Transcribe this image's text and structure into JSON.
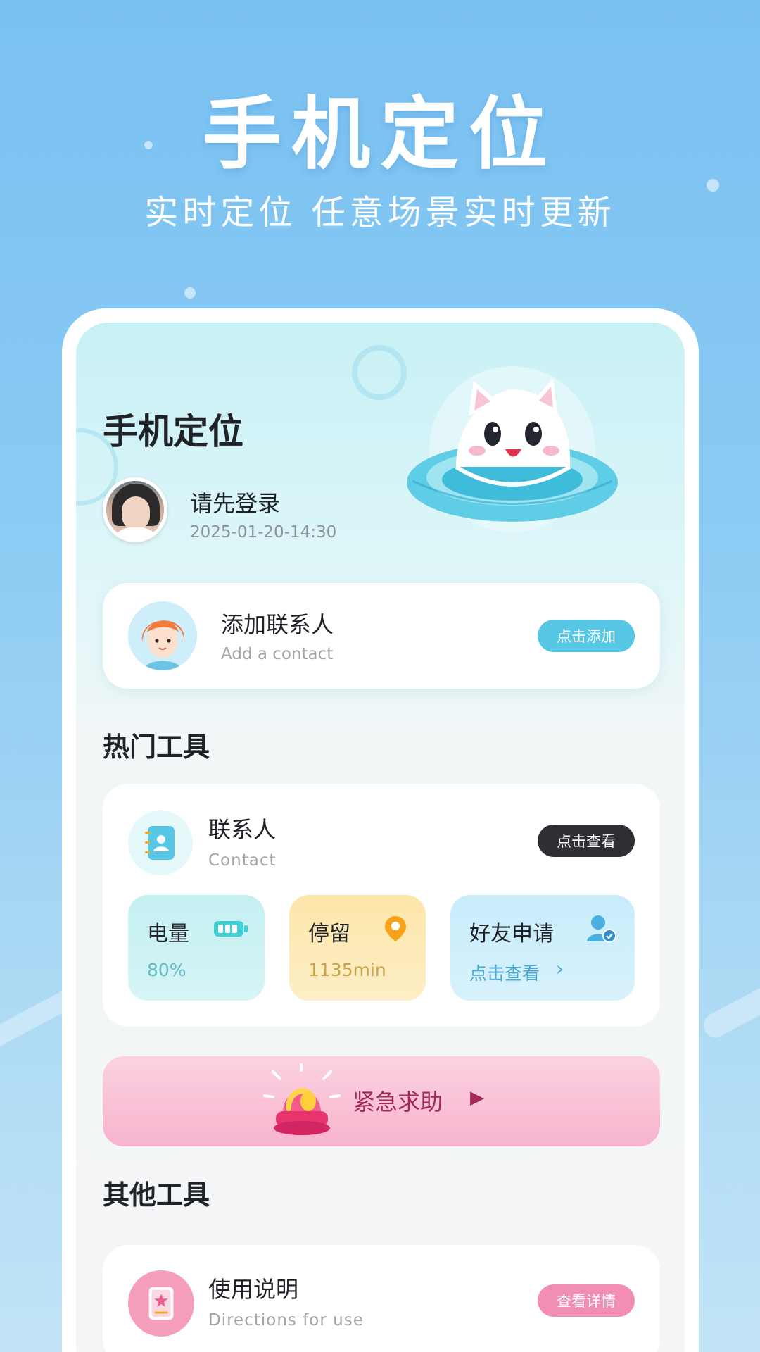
{
  "promo": {
    "title": "手机定位",
    "subtitle": "实时定位 任意场景实时更新"
  },
  "header": {
    "app_title": "手机定位",
    "login_text": "请先登录",
    "timestamp": "2025-01-20-14:30"
  },
  "add_contact": {
    "title": "添加联系人",
    "subtitle": "Add a contact",
    "button_label": "点击添加"
  },
  "hot_tools": {
    "section_title": "热门工具",
    "contact": {
      "title": "联系人",
      "subtitle": "Contact",
      "button_label": "点击查看"
    },
    "tiles": [
      {
        "label": "电量",
        "value": "80%",
        "icon": "battery-icon"
      },
      {
        "label": "停留",
        "value": "1135min",
        "icon": "location-pin-icon"
      },
      {
        "label": "好友申请",
        "value": "点击查看",
        "icon": "user-verified-icon"
      }
    ]
  },
  "sos": {
    "label": "紧急求助"
  },
  "other_tools": {
    "section_title": "其他工具",
    "manual": {
      "title": "使用说明",
      "subtitle": "Directions for use",
      "button_label": "查看详情"
    }
  },
  "colors": {
    "accent_cyan": "#56c8e6",
    "dark_button": "#2d2f33",
    "pink_button": "#f28db5",
    "battery_tile": "#c8f2f3",
    "stay_tile": "#fde7b0",
    "friend_tile": "#cdeefb"
  }
}
